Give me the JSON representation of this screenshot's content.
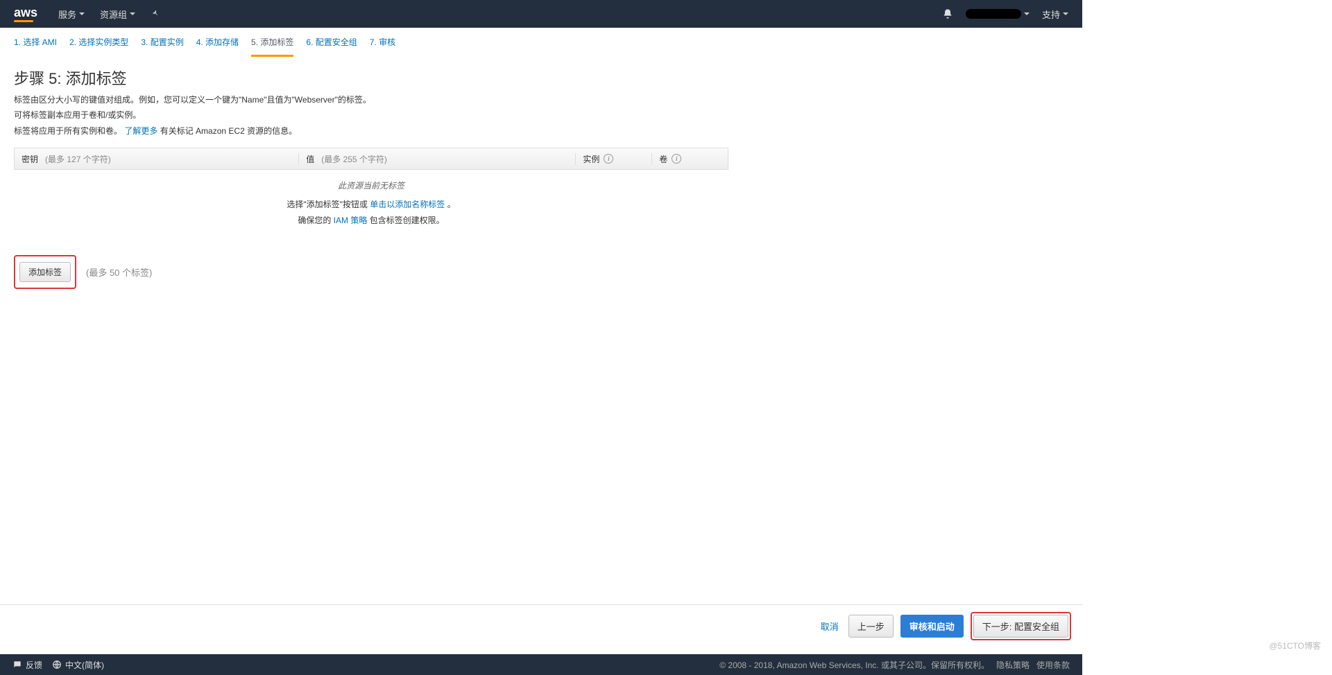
{
  "topbar": {
    "logo": "aws",
    "services": "服务",
    "resource_groups": "资源组",
    "support": "支持"
  },
  "wizard": {
    "steps": [
      "1. 选择 AMI",
      "2. 选择实例类型",
      "3. 配置实例",
      "4. 添加存储",
      "5. 添加标签",
      "6. 配置安全组",
      "7. 审核"
    ],
    "active_index": 4
  },
  "page": {
    "title": "步骤 5: 添加标签",
    "desc1": "标签由区分大小写的键值对组成。例如，您可以定义一个键为\"Name\"且值为\"Webserver\"的标签。",
    "desc2": "可将标签副本应用于卷和/或实例。",
    "desc3_prefix": "标签将应用于所有实例和卷。",
    "learn_more": "了解更多",
    "desc3_suffix": " 有关标记 Amazon EC2 资源的信息。"
  },
  "table": {
    "key_label": "密钥",
    "key_hint": "(最多 127 个字符)",
    "val_label": "值",
    "val_hint": "(最多 255 个字符)",
    "instance_label": "实例",
    "volume_label": "卷",
    "info_glyph": "i",
    "empty": "此资源当前无标签",
    "help1_prefix": "选择\"添加标签\"按钮或 ",
    "help1_link": "单击以添加名称标签",
    "help1_suffix": "。",
    "help2_prefix": "确保您的 ",
    "help2_link": "IAM 策略",
    "help2_suffix": " 包含标签创建权限。"
  },
  "add": {
    "button": "添加标签",
    "hint": "(最多 50 个标签)"
  },
  "footer": {
    "cancel": "取消",
    "prev": "上一步",
    "review_launch": "审核和启动",
    "next": "下一步: 配置安全组"
  },
  "bottom": {
    "feedback": "反馈",
    "language": "中文(简体)",
    "copyright": "© 2008 - 2018, Amazon Web Services, Inc. 或其子公司。保留所有权利。",
    "privacy": "隐私策略",
    "terms": "使用条款"
  },
  "watermark": "@51CTO博客"
}
